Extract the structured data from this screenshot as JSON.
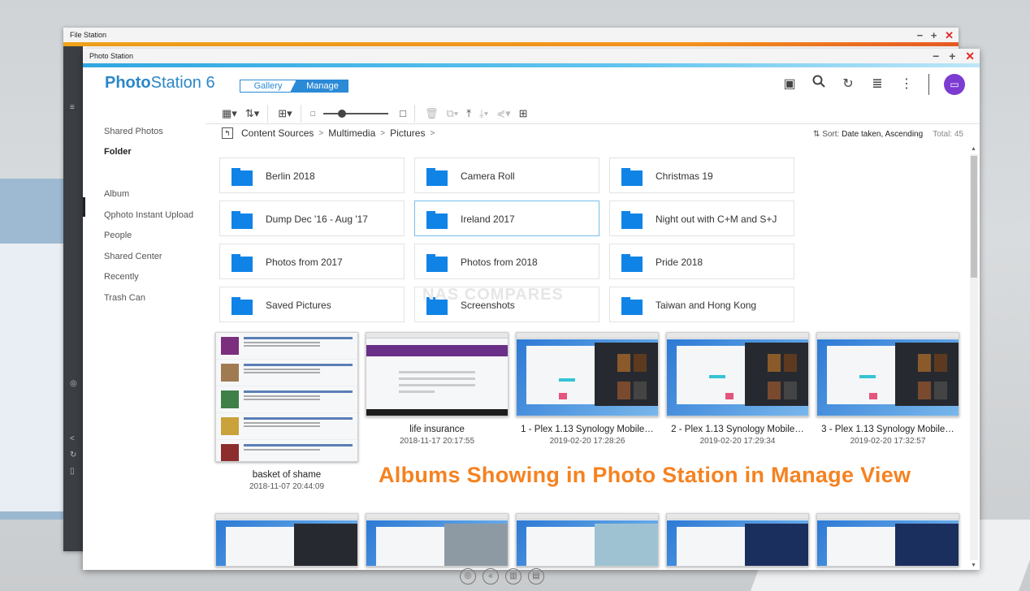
{
  "back_window": {
    "title": "File Station"
  },
  "window": {
    "title": "Photo Station",
    "minimize": "−",
    "maximize": "+",
    "close": "✕"
  },
  "header": {
    "logo_bold": "Photo",
    "logo_rest": "Station 6",
    "mode_gallery": "Gallery",
    "mode_manage": "Manage",
    "icons": [
      "slideshow-icon",
      "search-icon",
      "refresh-icon",
      "background-task-icon",
      "more-icon",
      "user-avatar"
    ]
  },
  "sidebar": {
    "items": [
      {
        "label": "Shared Photos"
      },
      {
        "label": "Folder"
      },
      {
        "label": "Album"
      },
      {
        "label": "Qphoto Instant Upload"
      },
      {
        "label": "People"
      },
      {
        "label": "Shared Center"
      },
      {
        "label": "Recently"
      },
      {
        "label": "Trash Can"
      }
    ]
  },
  "breadcrumb": {
    "items": [
      "Content Sources",
      "Multimedia",
      "Pictures"
    ]
  },
  "sort": {
    "label": "Sort:",
    "value": "Date taken, Ascending",
    "total": "Total: 45"
  },
  "folders": [
    "Berlin 2018",
    "Camera Roll",
    "Christmas 19",
    "Dump Dec '16 - Aug '17",
    "Ireland 2017",
    "Night out with C+M and S+J",
    "Photos from 2017",
    "Photos from 2018",
    "Pride 2018",
    "Saved Pictures",
    "Screenshots",
    "Taiwan and Hong Kong"
  ],
  "watermark": "NAS COMPARES",
  "photos": [
    {
      "title": "basket of shame",
      "date": "2018-11-07 20:44:09"
    },
    {
      "title": "life insurance",
      "date": "2018-11-17 20:17:55"
    },
    {
      "title": "1 - Plex 1.13 Synology Mobile…",
      "date": "2019-02-20 17:28:26"
    },
    {
      "title": "2 - Plex 1.13 Synology Mobile…",
      "date": "2019-02-20 17:29:34"
    },
    {
      "title": "3 - Plex 1.13 Synology Mobile…",
      "date": "2019-02-20 17:32:57"
    }
  ],
  "caption": "Albums Showing in Photo Station in Manage View",
  "colors": {
    "accent": "#2b87c8",
    "folder": "#1083e6",
    "caption": "#f58220"
  }
}
